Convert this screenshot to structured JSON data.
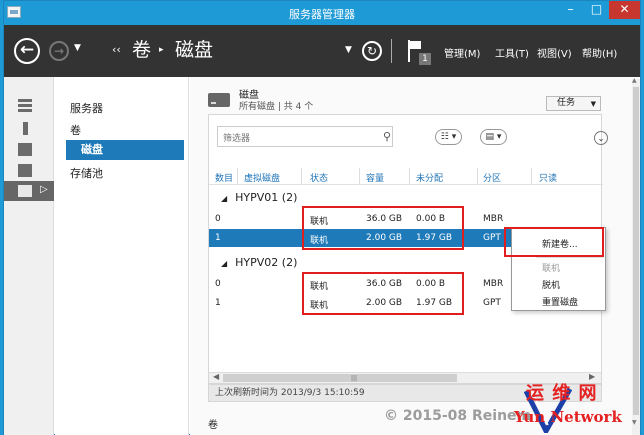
{
  "window": {
    "title": "服务器管理器",
    "controls": {
      "minimize": "–",
      "maximize": "□",
      "close": "✕"
    }
  },
  "toolbar": {
    "back": "←",
    "forward": "→",
    "nav_dropdown": "▼",
    "crumb_sep1": "‹‹",
    "crumb_volume": "卷",
    "crumb_sep2": "▸",
    "crumb_disk": "磁盘",
    "refresh_dropdown": "▼",
    "refresh": "↻",
    "notification_count": "1",
    "menus": [
      "管理(M)",
      "工具(T)",
      "视图(V)",
      "帮助(H)"
    ]
  },
  "sidebar": {
    "icons": [
      "dashboard-icon",
      "local-server-icon",
      "all-servers-icon",
      "file-services-icon"
    ],
    "active_arrow": "▷"
  },
  "subnav": {
    "items": [
      "服务器",
      "卷",
      "磁盘",
      "存储池"
    ],
    "active_index": 2
  },
  "section": {
    "title": "磁盘",
    "subtitle": "所有磁盘 | 共 4 个",
    "task_button": "任务",
    "volume_section": "卷"
  },
  "filter": {
    "placeholder": "筛选器",
    "search_icon": "⚲",
    "list_icon": "☷ ▾",
    "save_icon": "▤ ▾",
    "expand_icon": "⌄"
  },
  "table": {
    "headers": [
      "数目",
      "虚拟磁盘",
      "状态",
      "容量",
      "未分配",
      "分区",
      "只读"
    ],
    "groups": [
      {
        "name": "HYPV01 (2)",
        "rows": [
          {
            "num": "0",
            "status": "联机",
            "capacity": "36.0 GB",
            "unallocated": "0.00 B",
            "partition": "MBR",
            "selected": false
          },
          {
            "num": "1",
            "status": "联机",
            "capacity": "2.00 GB",
            "unallocated": "1.97 GB",
            "partition": "GPT",
            "selected": true
          }
        ]
      },
      {
        "name": "HYPV02 (2)",
        "rows": [
          {
            "num": "0",
            "status": "联机",
            "capacity": "36.0 GB",
            "unallocated": "0.00 B",
            "partition": "MBR",
            "selected": false
          },
          {
            "num": "1",
            "status": "联机",
            "capacity": "2.00 GB",
            "unallocated": "1.97 GB",
            "partition": "GPT",
            "selected": false
          }
        ]
      }
    ],
    "caret": "◢"
  },
  "footer": {
    "last_refresh": "上次刷新时间为 2013/9/3 15:10:59"
  },
  "scroll": {
    "left": "◀",
    "right": "▶",
    "grip": "|||",
    "up": "▲",
    "down": "▼"
  },
  "context_menu": {
    "items": [
      {
        "label": "新建卷...",
        "disabled": false
      },
      {
        "label": "联机",
        "disabled": true
      },
      {
        "label": "脱机",
        "disabled": false
      },
      {
        "label": "重置磁盘",
        "disabled": false
      }
    ]
  },
  "watermark": {
    "text": "© 2015-08 Reinem",
    "logo_top": "运 维 网",
    "logo_bottom": "Yun  Network"
  },
  "colors": {
    "accent": "#1e7ab8",
    "title_bar": "#1e9ad6",
    "toolbar": "#333333",
    "highlight": "#e01e1e"
  }
}
